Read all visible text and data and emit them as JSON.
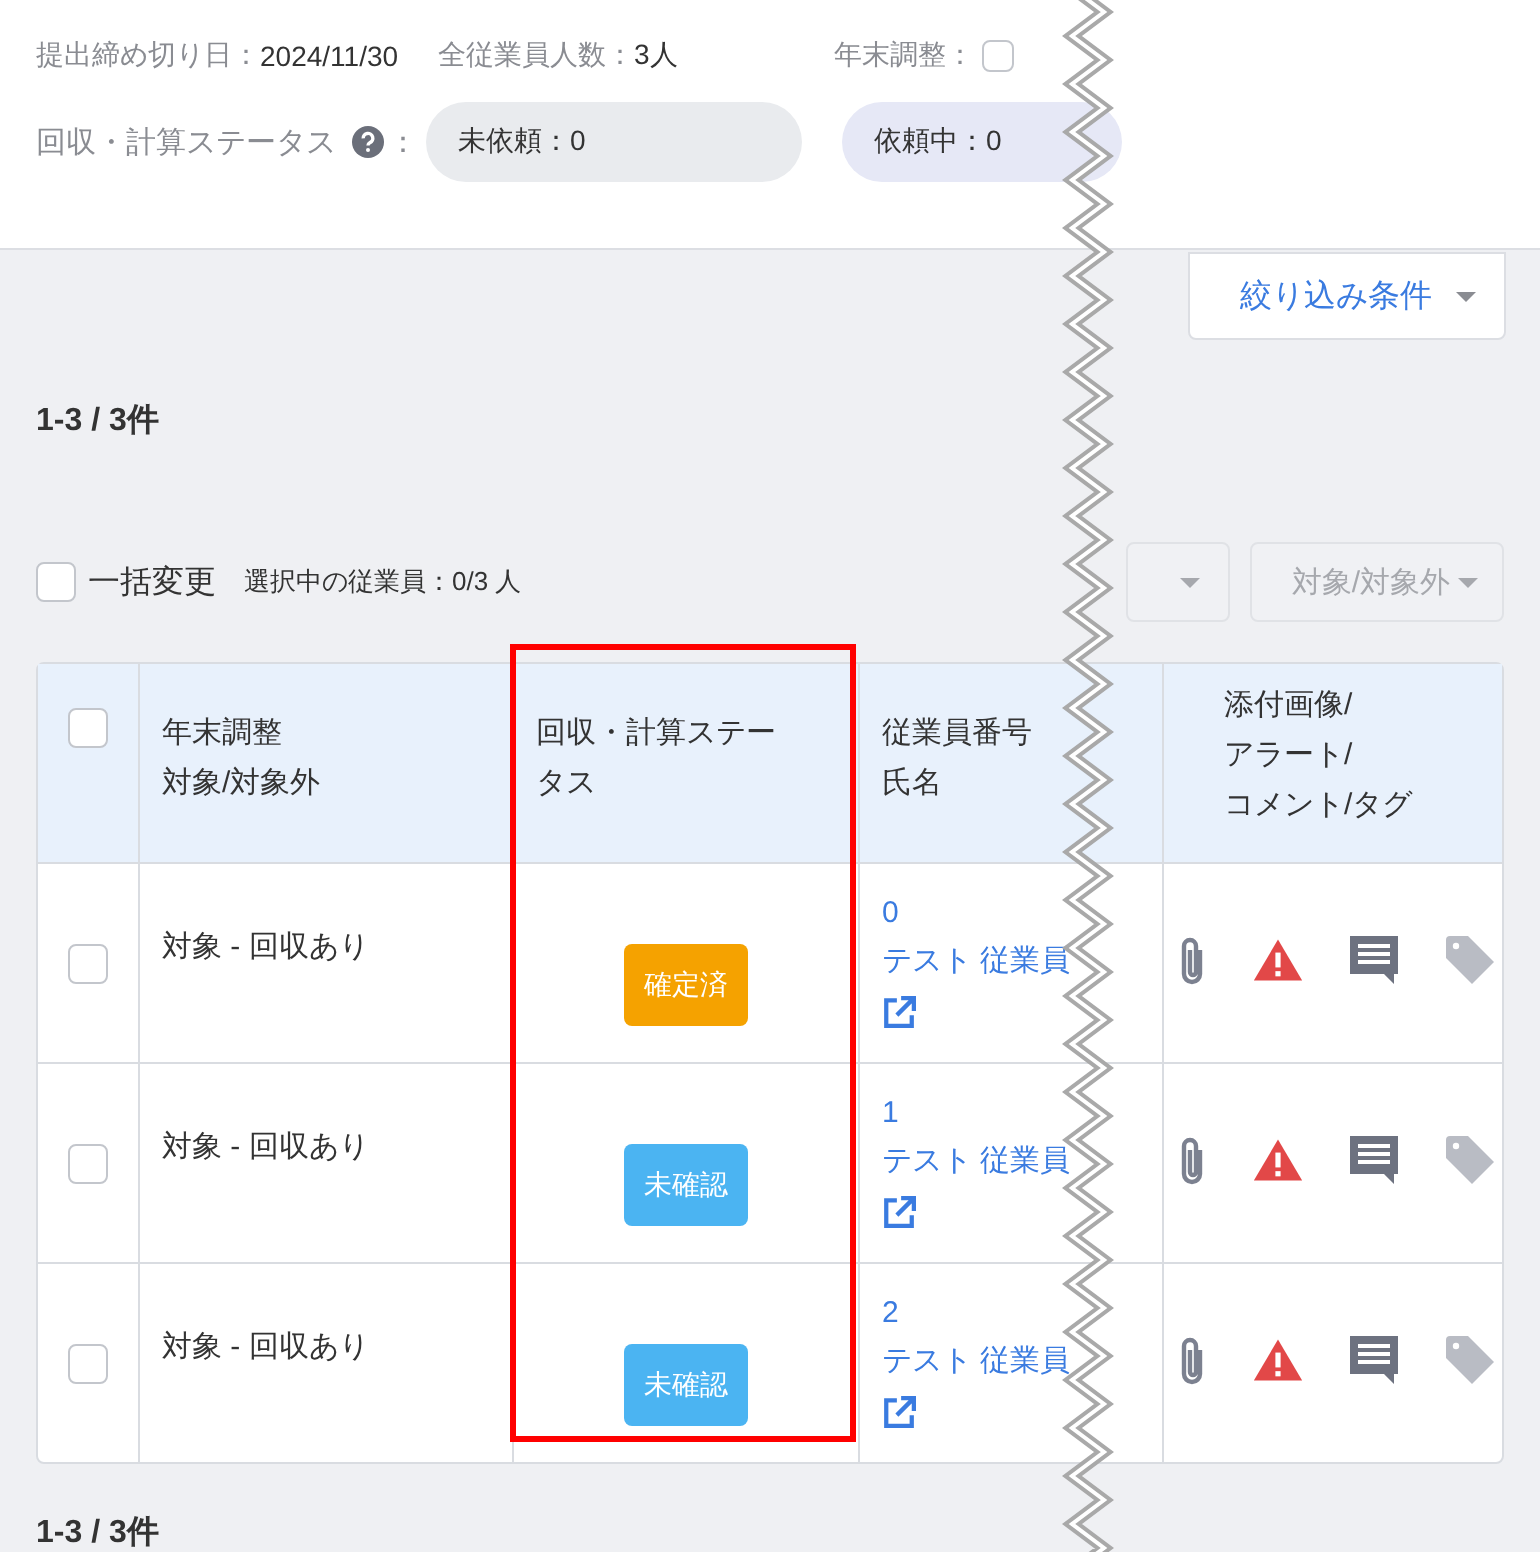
{
  "header": {
    "deadline_label": "提出締め切り日：",
    "deadline": "2024/11/30",
    "employees_label": "全従業員人数：",
    "employees": "3人",
    "year_end_label": "年末調整：",
    "year_end_checked": false
  },
  "status_filter": {
    "label": "回収・計算ステータス",
    "colon": "：",
    "pills": [
      {
        "label": "未依頼：0",
        "color": "#e9ebee"
      },
      {
        "label": "依頼中：0",
        "color": "#e6e8f6"
      }
    ]
  },
  "filter_button": "絞り込み条件",
  "count_top": "1-3 / 3件",
  "bulk": {
    "label": "一括変更",
    "checked": false,
    "selected_text": "選択中の従業員：0/3 人",
    "button": "対象/対象外"
  },
  "table": {
    "header_checked": false,
    "columns": [
      [
        "年末調整",
        "対象/対象外"
      ],
      [
        "回収・計算ステー",
        "タス"
      ],
      [
        "従業員番号",
        "氏名"
      ],
      [
        "添付画像/",
        "アラート/",
        "コメント/タグ"
      ]
    ],
    "rows": [
      {
        "checked": false,
        "target": "対象 - 回収あり",
        "status": {
          "label": "確定済",
          "color": "#f5a200"
        },
        "number": "0",
        "name": "テスト 従業員"
      },
      {
        "checked": false,
        "target": "対象 - 回収あり",
        "status": {
          "label": "未確認",
          "color": "#4bb4f2"
        },
        "number": "1",
        "name": "テスト 従業員"
      },
      {
        "checked": false,
        "target": "対象 - 回収あり",
        "status": {
          "label": "未確認",
          "color": "#4bb4f2"
        },
        "number": "2",
        "name": "テスト 従業員"
      }
    ]
  },
  "count_bottom": "1-3 / 3件"
}
